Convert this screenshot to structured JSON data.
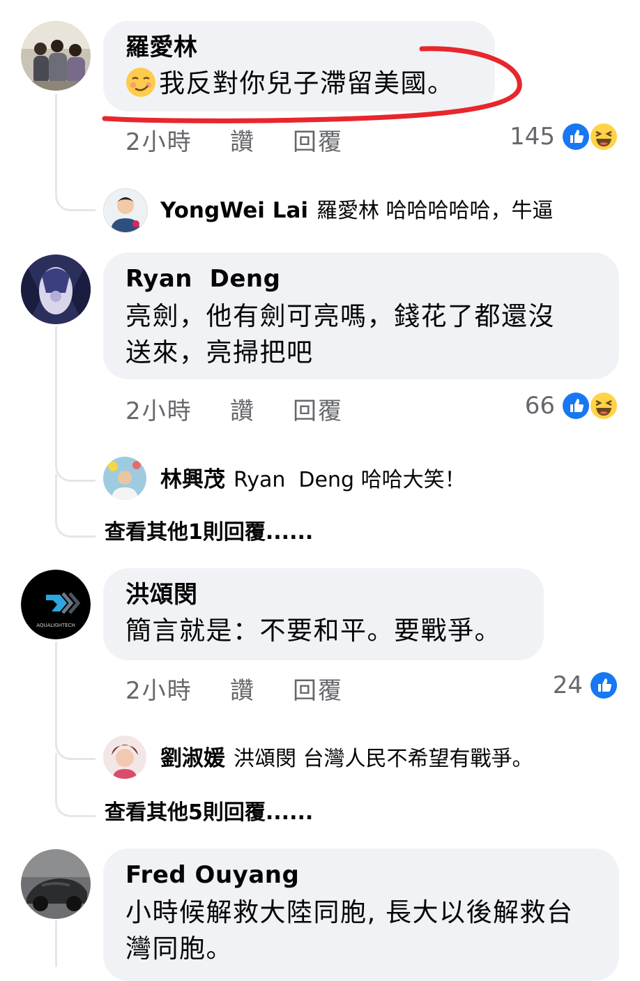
{
  "comments": [
    {
      "name": "羅愛林",
      "text": "我反對你兒子滯留美國。",
      "time": "2小時",
      "like": "讚",
      "reply": "回覆",
      "reactions": "145",
      "reaction_icons": [
        "like-icon",
        "haha-icon"
      ],
      "replies": [
        {
          "name": "YongWei Lai",
          "text": "羅愛林 哈哈哈哈哈，牛逼"
        }
      ]
    },
    {
      "name": "Ryan  Deng",
      "text_lines": [
        "亮劍，他有劍可亮嗎，錢花了都還沒",
        "送來，亮掃把吧"
      ],
      "time": "2小時",
      "like": "讚",
      "reply": "回覆",
      "reactions": "66",
      "reaction_icons": [
        "like-icon",
        "haha-icon"
      ],
      "replies": [
        {
          "name": "林興茂",
          "text": "Ryan  Deng 哈哈大笑！"
        }
      ],
      "more_replies": "查看其他1則回覆......"
    },
    {
      "name": "洪頌閔",
      "text": "簡言就是：不要和平。要戰爭。",
      "avatar_caption": "AQUALIGHTECH",
      "time": "2小時",
      "like": "讚",
      "reply": "回覆",
      "reactions": "24",
      "reaction_icons": [
        "like-icon"
      ],
      "replies": [
        {
          "name": "劉淑媛",
          "text": "洪頌閔 台灣人民不希望有戰爭。"
        }
      ],
      "more_replies": "查看其他5則回覆......"
    },
    {
      "name": "Fred Ouyang",
      "text_lines": [
        "小時候解救大陸同胞, 長大以後解救台",
        "灣同胞。"
      ]
    }
  ],
  "colors": {
    "bubble": "#f0f2f5",
    "thread_line": "#e4e6eb",
    "meta_text": "#65676b",
    "like_blue": "#1877f2",
    "annotation_red": "#e8262d"
  }
}
